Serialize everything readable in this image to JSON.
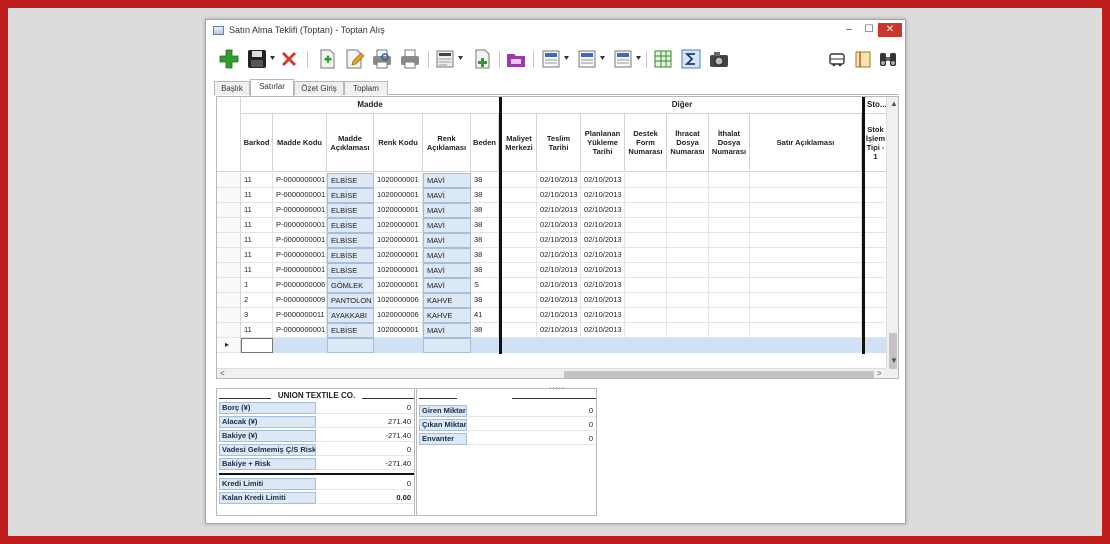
{
  "window": {
    "title": "Satın Alma Teklifi (Toptan) - Toptan Alış",
    "minimize": "–",
    "maximize": "☐",
    "close": "✕"
  },
  "tabs": [
    "Başlık",
    "Satırlar",
    "Özet Giriş",
    "Toplam"
  ],
  "active_tab": "Satırlar",
  "grid": {
    "groups": {
      "madde": "Madde",
      "diger": "Diğer",
      "stok": "Sto..."
    },
    "columns": [
      "Barkod",
      "Madde Kodu",
      "Madde Açıklaması",
      "Renk Kodu",
      "Renk Açıklaması",
      "Beden",
      "Maliyet Merkezi",
      "Teslim Tarihi",
      "Planlanan Yükleme Tarihi",
      "Destek Form Numarası",
      "İhracat Dosya Numarası",
      "İthalat Dosya Numarası",
      "Satır Açıklaması",
      "Stok İşlem Tipi - 1"
    ],
    "rows": [
      [
        "11",
        "P-0000000001",
        "ELBİSE",
        "1020000001",
        "MAVİ",
        "38",
        "",
        "02/10/2013",
        "02/10/2013"
      ],
      [
        "11",
        "P-0000000001",
        "ELBİSE",
        "1020000001",
        "MAVİ",
        "38",
        "",
        "02/10/2013",
        "02/10/2013"
      ],
      [
        "11",
        "P-0000000001",
        "ELBİSE",
        "1020000001",
        "MAVİ",
        "38",
        "",
        "02/10/2013",
        "02/10/2013"
      ],
      [
        "11",
        "P-0000000001",
        "ELBİSE",
        "1020000001",
        "MAVİ",
        "38",
        "",
        "02/10/2013",
        "02/10/2013"
      ],
      [
        "11",
        "P-0000000001",
        "ELBİSE",
        "1020000001",
        "MAVİ",
        "38",
        "",
        "02/10/2013",
        "02/10/2013"
      ],
      [
        "11",
        "P-0000000001",
        "ELBİSE",
        "1020000001",
        "MAVİ",
        "38",
        "",
        "02/10/2013",
        "02/10/2013"
      ],
      [
        "11",
        "P-0000000001",
        "ELBİSE",
        "1020000001",
        "MAVİ",
        "38",
        "",
        "02/10/2013",
        "02/10/2013"
      ],
      [
        "1",
        "P-0000000006",
        "GÖMLEK",
        "1020000001",
        "MAVİ",
        "S",
        "",
        "02/10/2013",
        "02/10/2013"
      ],
      [
        "2",
        "P-0000000009",
        "PANTOLON",
        "1020000006",
        "KAHVE",
        "38",
        "",
        "02/10/2013",
        "02/10/2013"
      ],
      [
        "3",
        "P-0000000011",
        "AYAKKABI",
        "1020000006",
        "KAHVE",
        "41",
        "",
        "02/10/2013",
        "02/10/2013"
      ],
      [
        "11",
        "P-0000000001",
        "ELBİSE",
        "1020000001",
        "MAVİ",
        "38",
        "",
        "02/10/2013",
        "02/10/2013"
      ]
    ],
    "new_row_marker": "▸",
    "scroll_left": "<",
    "scroll_right": ">",
    "scroll_up": "▲",
    "scroll_down": "▼"
  },
  "splitter": ".....",
  "account": {
    "company": "UNION TEXTILE CO.",
    "items": [
      {
        "label": "Borç (¥)",
        "value": "0"
      },
      {
        "label": "Alacak (¥)",
        "value": "271.40"
      },
      {
        "label": "Bakiye (¥)",
        "value": "-271.40"
      },
      {
        "label": "Vadesi Gelmemiş Ç/S Riski",
        "value": "0"
      },
      {
        "label": "Bakiye + Risk",
        "value": "-271.40"
      },
      {
        "label": "Kredi Limiti",
        "value": "0"
      },
      {
        "label": "Kalan Kredi Limiti",
        "value": "0.00"
      }
    ]
  },
  "stock": {
    "items": [
      {
        "label": "Giren Miktar",
        "value": "0"
      },
      {
        "label": "Çıkan Miktar",
        "value": "0"
      },
      {
        "label": "Envanter",
        "value": "0"
      }
    ]
  },
  "colors": {
    "lookup_bg": "#dce8f6",
    "new_row": "#cfe1f3",
    "border_frame": "#c01d1d",
    "close_button": "#c8382e"
  }
}
